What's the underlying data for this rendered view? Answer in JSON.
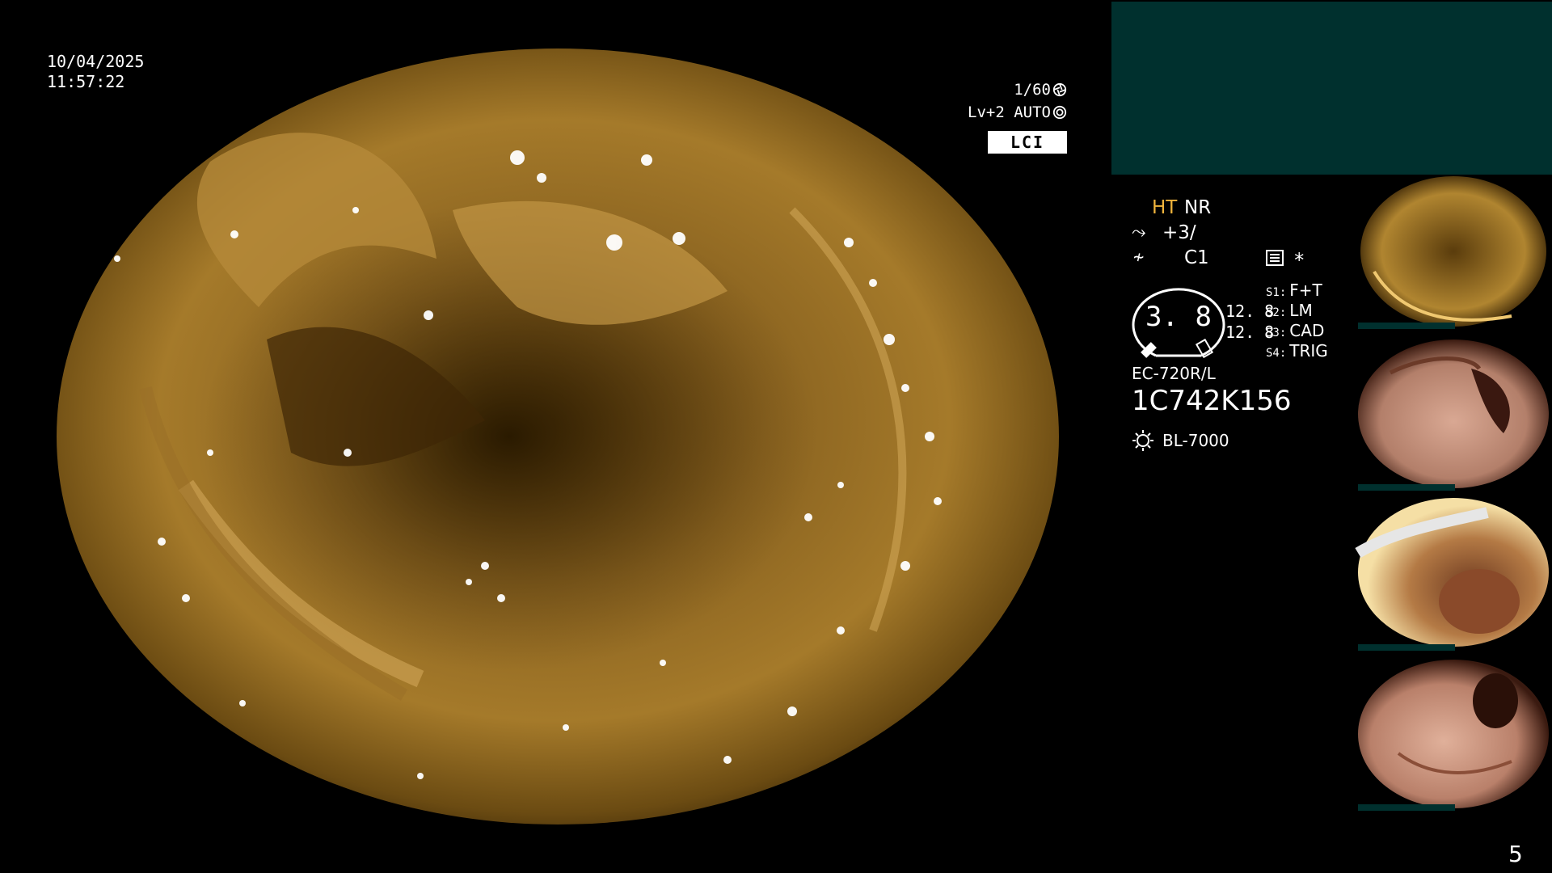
{
  "overlay": {
    "date": "10/04/2025",
    "time": "11:57:22",
    "shutter": "1/60",
    "level": "Lv+2 AUTO",
    "mode": "LCI"
  },
  "settings": {
    "ht": "HT",
    "nr": "NR",
    "enhancement": "+3/",
    "color": "C1",
    "star": "*",
    "gauge_value": "3. 8",
    "value_a": "12. 8",
    "value_b": "12. 8",
    "slots": [
      {
        "key": "S1:",
        "value": "F+T"
      },
      {
        "key": "S2:",
        "value": "LM"
      },
      {
        "key": "S3:",
        "value": "CAD"
      },
      {
        "key": "S4:",
        "value": "TRIG"
      }
    ],
    "scope_model": "EC-720R/L",
    "scope_serial": "1C742K156",
    "light_source": "BL-7000"
  },
  "page_number": "5",
  "colors": {
    "accent": "#f0b43c",
    "teal_panel": "#00302e",
    "tissue_dark": "#3a2600",
    "tissue_light": "#c7963f"
  },
  "icons": {
    "shutter": "aperture-icon",
    "level": "iris-icon",
    "enhancement": "structure-icon",
    "color": "color-icon",
    "memo": "memo-icon",
    "light": "light-source-icon"
  }
}
